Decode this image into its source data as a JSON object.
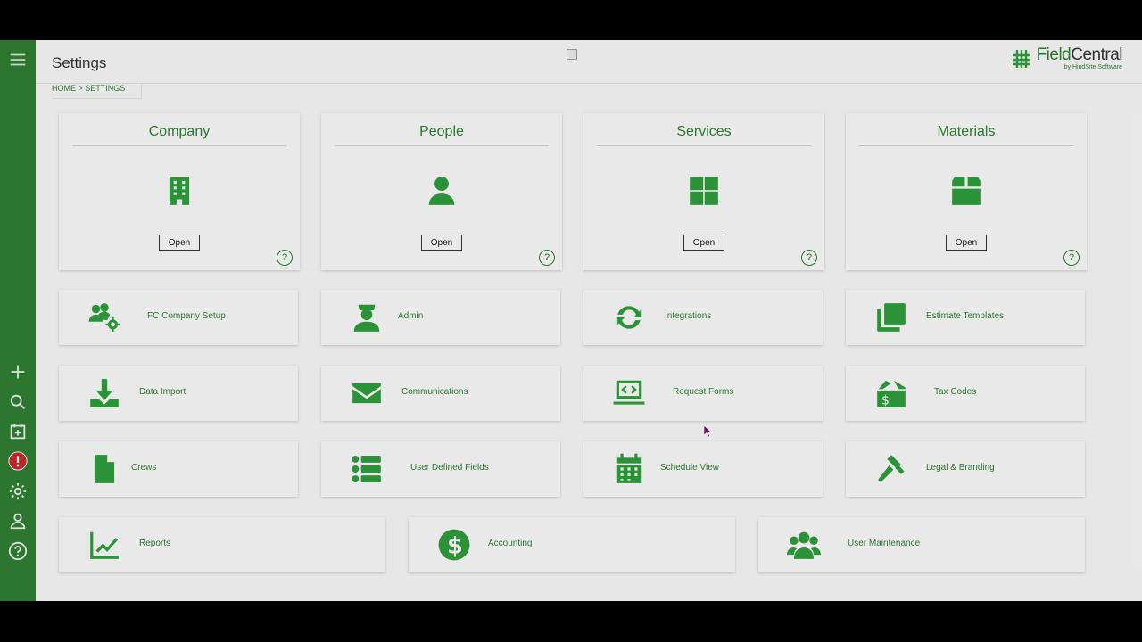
{
  "header": {
    "title": "Settings",
    "breadcrumb": "HOME > SETTINGS",
    "logo": {
      "main_a": "Field",
      "main_b": "Central",
      "sub": "by HindSite Software"
    }
  },
  "sidebar": {
    "icons": [
      "menu-icon",
      "plus-icon",
      "search-icon",
      "calendar-plus-icon",
      "alert-icon",
      "gear-icon",
      "user-icon",
      "help-icon"
    ]
  },
  "main_cards": [
    {
      "title": "Company",
      "icon": "building-icon",
      "open_label": "Open",
      "help": "?"
    },
    {
      "title": "People",
      "icon": "person-icon",
      "open_label": "Open",
      "help": "?"
    },
    {
      "title": "Services",
      "icon": "grid-icon",
      "open_label": "Open",
      "help": "?"
    },
    {
      "title": "Materials",
      "icon": "box-icon",
      "open_label": "Open",
      "help": "?"
    }
  ],
  "tiles": [
    {
      "label": "FC Company Setup",
      "icon": "users-gear-icon"
    },
    {
      "label": "Admin",
      "icon": "admin-icon"
    },
    {
      "label": "Integrations",
      "icon": "sync-icon"
    },
    {
      "label": "Estimate Templates",
      "icon": "copy-icon"
    },
    {
      "label": "Data Import",
      "icon": "download-icon"
    },
    {
      "label": "Communications",
      "icon": "envelope-icon"
    },
    {
      "label": "Request Forms",
      "icon": "laptop-code-icon"
    },
    {
      "label": "Tax Codes",
      "icon": "tax-icon"
    },
    {
      "label": "Crews",
      "icon": "file-icon"
    },
    {
      "label": "User Defined Fields",
      "icon": "list-icon"
    },
    {
      "label": "Schedule View",
      "icon": "calendar-icon"
    },
    {
      "label": "Legal & Branding",
      "icon": "gavel-icon"
    },
    {
      "label": "Reports",
      "icon": "chart-icon"
    },
    {
      "label": "Accounting",
      "icon": "dollar-icon"
    },
    {
      "label": "User Maintenance",
      "icon": "users-icon"
    }
  ],
  "colors": {
    "sidebar": "#2f7d32",
    "accent": "#2f9a3a",
    "background": "#f4f4f4"
  }
}
